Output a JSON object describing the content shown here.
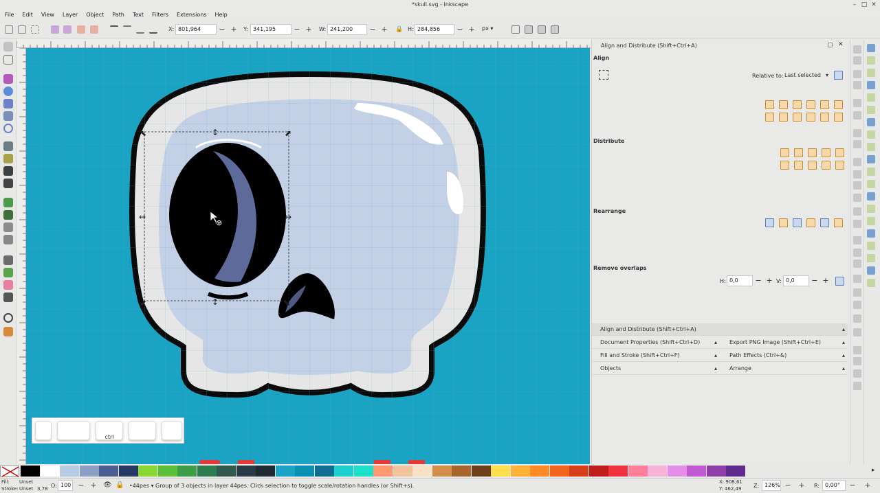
{
  "window": {
    "title": "*skull.svg - Inkscape"
  },
  "menu": [
    "File",
    "Edit",
    "View",
    "Layer",
    "Object",
    "Path",
    "Text",
    "Filters",
    "Extensions",
    "Help"
  ],
  "toolbar": {
    "x_label": "X:",
    "x_value": "801,964",
    "y_label": "Y:",
    "y_value": "341,195",
    "w_label": "W:",
    "w_value": "241,200",
    "h_label": "H:",
    "h_value": "284,856",
    "unit": "px"
  },
  "panel": {
    "title": "Align and Distribute (Shift+Ctrl+A)",
    "align_heading": "Align",
    "relative_label": "Relative to:",
    "relative_value": "Last selected",
    "distribute_heading": "Distribute",
    "rearrange_heading": "Rearrange",
    "remove_overlaps_heading": "Remove overlaps",
    "h_label": "H:",
    "h_value": "0,0",
    "v_label": "V:",
    "v_value": "0,0"
  },
  "docks": {
    "align": "Align and Distribute (Shift+Ctrl+A)",
    "doc_props": "Document Properties (Shift+Ctrl+D)",
    "export_png": "Export PNG Image (Shift+Ctrl+E)",
    "fill_stroke": "Fill and Stroke (Shift+Ctrl+F)",
    "path_effects": "Path Effects (Ctrl+&)",
    "objects": "Objects",
    "arrange": "Arrange"
  },
  "keys": {
    "ctrl": "ctrl"
  },
  "palette": [
    "#000000",
    "#ffffff",
    "#b7cbe4",
    "#8d9fc4",
    "#4c5e8f",
    "#283a64",
    "#8ad634",
    "#5bbf3a",
    "#3e9e47",
    "#2c7e51",
    "#2f5a4d",
    "#2a3b48",
    "#1f2a33",
    "#1aa3c4",
    "#0b8fb3",
    "#0d6d93",
    "#1ecfce",
    "#1edfc9",
    "#ff9a70",
    "#f2c39e",
    "#f7e2c6",
    "#d28f4c",
    "#a8652e",
    "#6e3f1b",
    "#ffde52",
    "#ffb23a",
    "#ff8a26",
    "#f2631f",
    "#d6401a",
    "#c21d1d",
    "#ee3240",
    "#ff7f9a",
    "#f8b2d7",
    "#e58ee8",
    "#c05ad1",
    "#8f3ea8",
    "#5f2b8e"
  ],
  "status": {
    "fill_label": "Fill:",
    "fill_value": "Unset",
    "stroke_label": "Stroke:",
    "stroke_value": "Unset",
    "stroke_width": "3,78",
    "opacity_label": "O:",
    "opacity_value": "100",
    "layer": "•44pes",
    "message": "Group of 3 objects in layer 44pes. Click selection to toggle scale/rotation handles (or Shift+s).",
    "cursor_x": "X: 908,61",
    "cursor_y": "Y: 462,49",
    "zoom_label": "Z:",
    "zoom_value": "126%",
    "rotate_label": "R:",
    "rotate_value": "0,00°"
  }
}
